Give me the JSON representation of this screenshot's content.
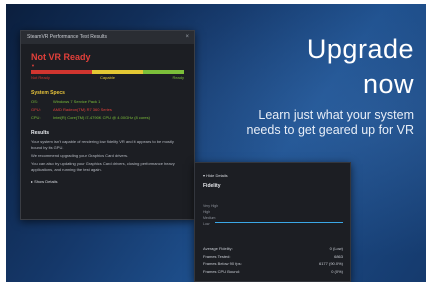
{
  "hero": {
    "title_line1": "Upgrade",
    "title_line2": "now",
    "subtitle_line1": "Learn just what your system",
    "subtitle_line2": "needs to get geared up for VR"
  },
  "results_window": {
    "title": "SteamVR Performance Test Results",
    "close_glyph": "×",
    "verdict": "Not VR Ready",
    "verdict_mark": "▼",
    "meter_labels": [
      "Not Ready",
      "Capable",
      "Ready"
    ],
    "system_specs_title": "System Specs",
    "specs": [
      {
        "key": "OS:",
        "value": "Windows 7 Service Pack 1",
        "status": "ok"
      },
      {
        "key": "GPU:",
        "value": "AMD Radeon(TM) R7 360 Series",
        "status": "bad"
      },
      {
        "key": "CPU:",
        "value": "Intel(R) Core(TM) i7-4790K CPU @ 4.00GHz (8 cores)",
        "status": "ok"
      }
    ],
    "results_title": "Results",
    "results_paragraphs": [
      "Your system isn't capable of rendering low fidelity VR and it appears to be mostly bound by its GPU.",
      "We recommend upgrading your Graphics Card drivers.",
      "You can also try updating your Graphics Card drivers, closing performance heavy applications, and running the test again."
    ],
    "show_details": "▸  Show Details"
  },
  "fidelity_panel": {
    "hide_details": "▾  Hide Details",
    "title": "Fidelity",
    "levels": [
      "Very High",
      "High",
      "Medium",
      "Low"
    ],
    "metrics": [
      {
        "label": "Average Fidelity:",
        "value": "0 (Low)"
      },
      {
        "label": "Frames Tested:",
        "value": "6863"
      },
      {
        "label": "Frames Below 90 fps:",
        "value": "6177 (90.0%)"
      },
      {
        "label": "Frames CPU Bound:",
        "value": "0 (0%)"
      }
    ]
  },
  "colors": {
    "background": "#15386a",
    "not_ready_red": "#d0352f",
    "capable_yellow": "#e4c834",
    "ready_green": "#7cbf3a",
    "fidelity_line": "#3ba7e6"
  }
}
